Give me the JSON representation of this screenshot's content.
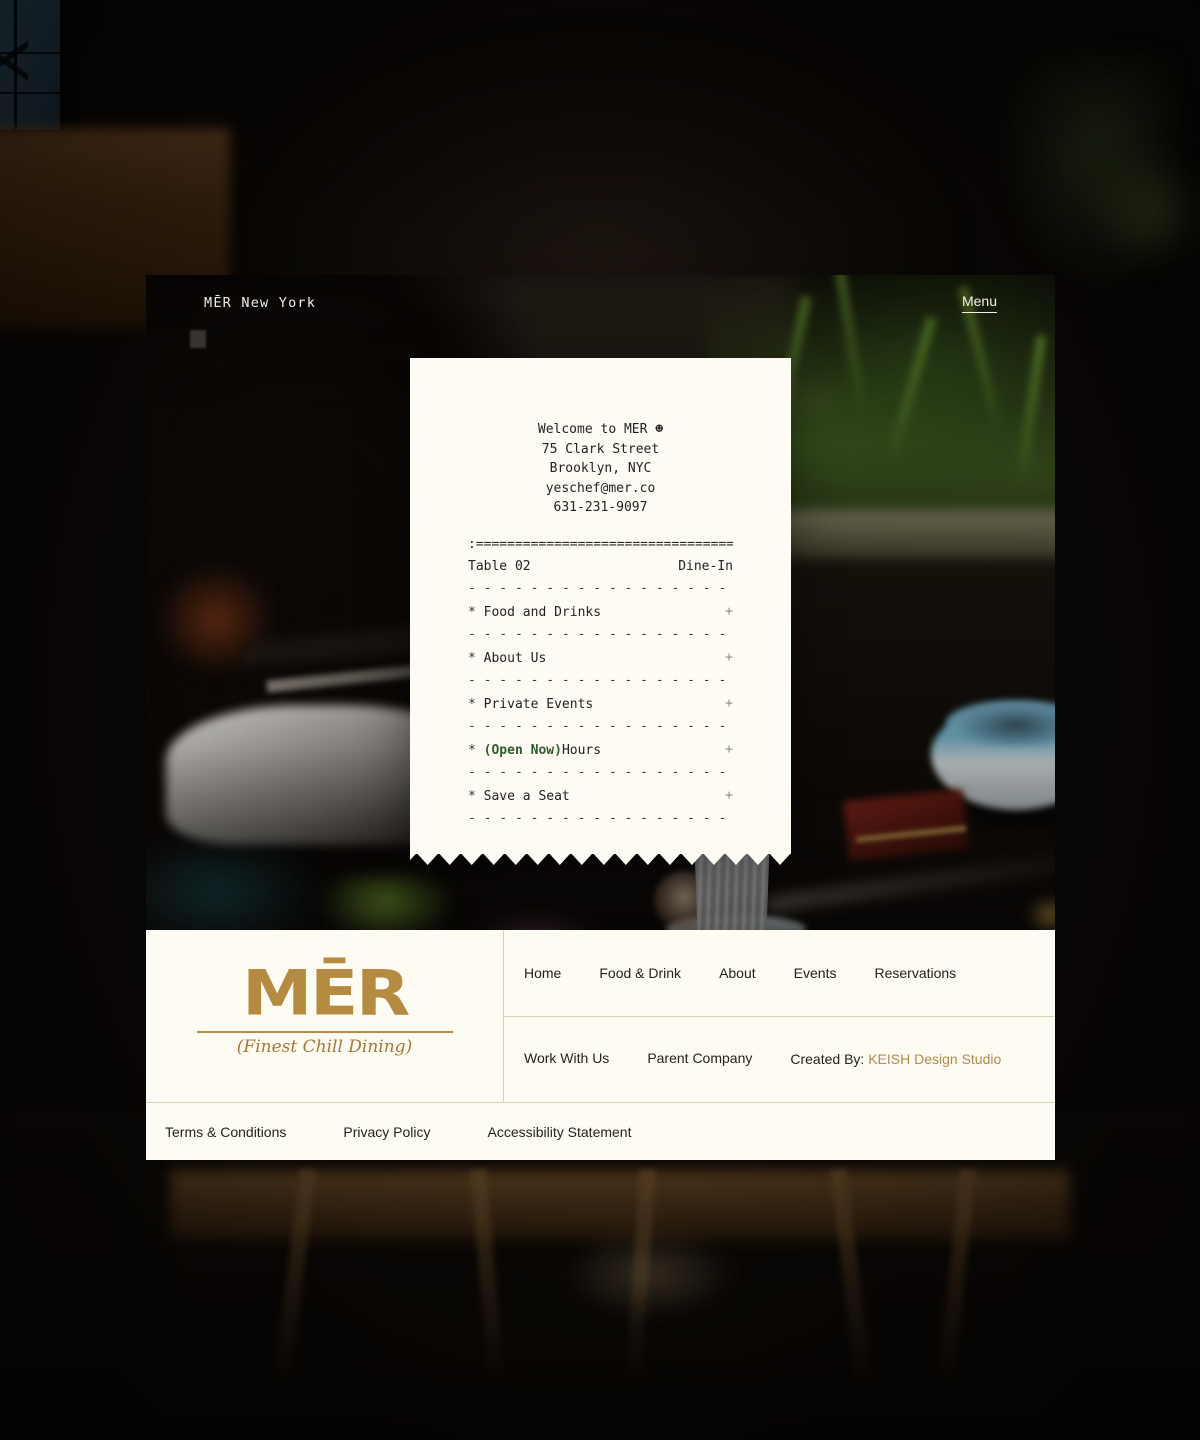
{
  "header": {
    "brand": "MĒR New York",
    "menu_label": "Menu"
  },
  "receipt": {
    "welcome": "Welcome to MER ☻",
    "address_line1": "75 Clark Street",
    "address_line2": "Brooklyn, NYC",
    "email": "yeschef@mer.co",
    "phone": "631-231-9097",
    "rule_double": ":=================================:",
    "rule_dashed": "- - - - - - - - - - - - - - - - - - - - - -",
    "table_label": "Table 02",
    "service_label": "Dine-In",
    "items": [
      {
        "star": "*",
        "label": "Food and Drinks",
        "badge": "",
        "expander": "+"
      },
      {
        "star": "*",
        "label": "About Us",
        "badge": "",
        "expander": "+"
      },
      {
        "star": "*",
        "label": "Private Events",
        "badge": "",
        "expander": "+"
      },
      {
        "star": "*",
        "label": "Hours",
        "badge": "(Open Now)",
        "expander": "+"
      },
      {
        "star": "*",
        "label": "Save a Seat",
        "badge": "",
        "expander": "+"
      }
    ]
  },
  "footer": {
    "logo_mark": "MĒR",
    "logo_tagline": "(Finest Chill Dining)",
    "primary_nav": [
      {
        "label": "Home"
      },
      {
        "label": "Food & Drink"
      },
      {
        "label": "About"
      },
      {
        "label": "Events"
      },
      {
        "label": "Reservations"
      }
    ],
    "secondary_nav": [
      {
        "label": "Work With Us"
      },
      {
        "label": "Parent Company"
      }
    ],
    "credit_prefix": "Created By:",
    "credit_studio": "KEISH Design Studio",
    "legal_nav": [
      {
        "label": "Terms & Conditions"
      },
      {
        "label": "Privacy Policy"
      },
      {
        "label": "Accessibility Statement"
      }
    ]
  },
  "colors": {
    "gold": "#b58a41",
    "cream": "#fdfbf2",
    "receipt_paper": "#fdfbf3",
    "open_now_green": "#2f5d2a",
    "credit_link": "#b08b4f"
  }
}
